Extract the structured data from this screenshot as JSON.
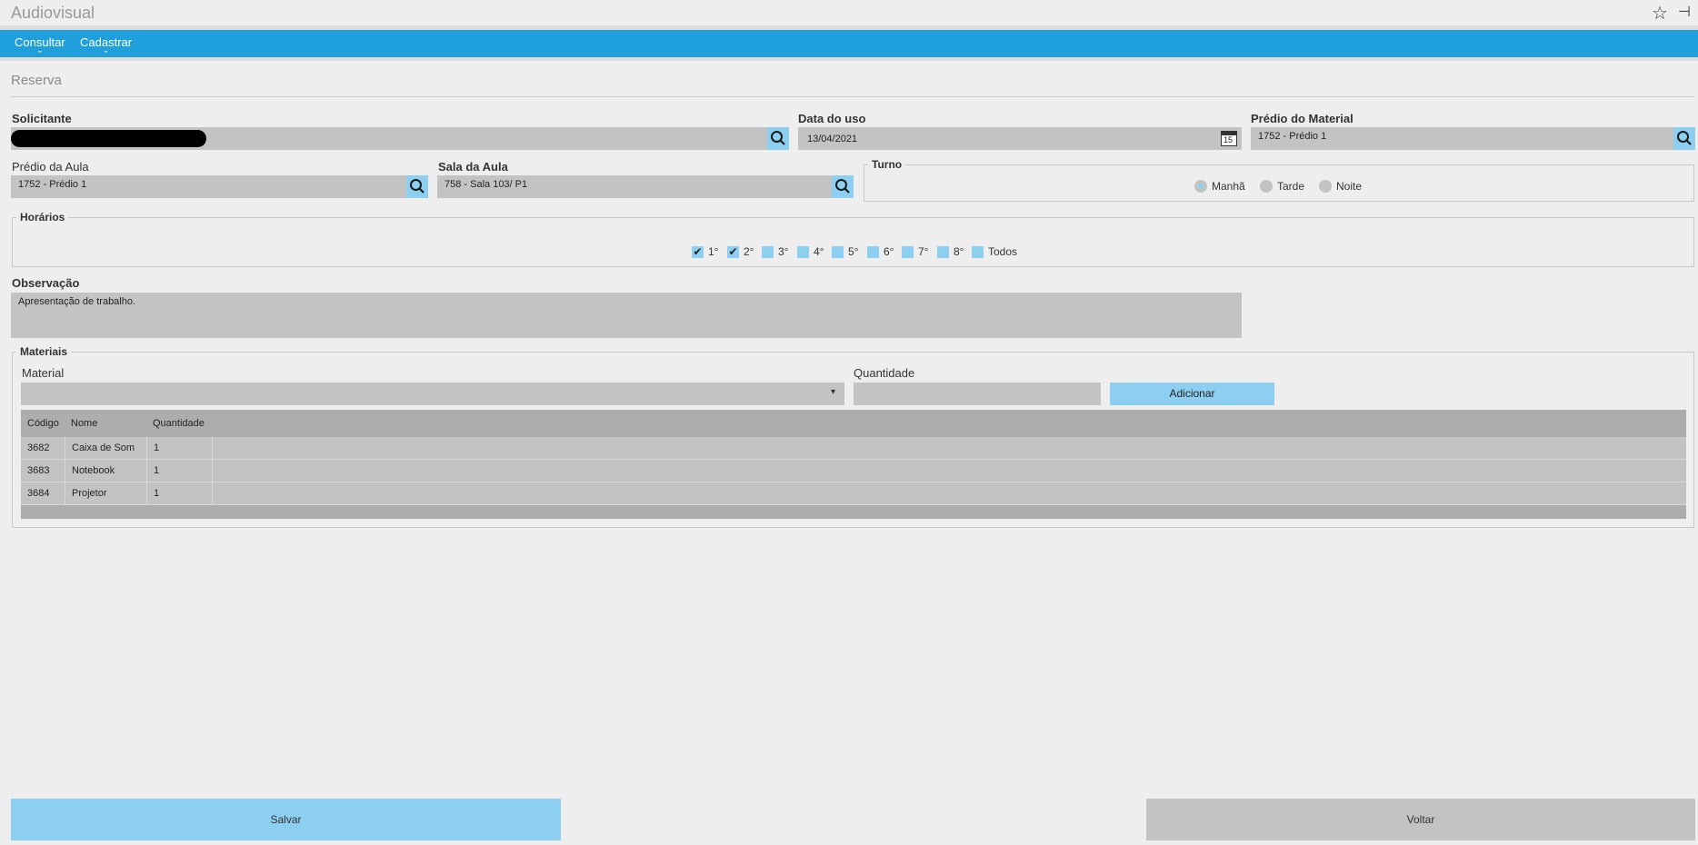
{
  "app": {
    "title": "Audiovisual"
  },
  "menu": [
    {
      "label": "Consultar"
    },
    {
      "label": "Cadastrar"
    }
  ],
  "section": {
    "title": "Reserva"
  },
  "solicitante": {
    "label": "Solicitante",
    "value": ""
  },
  "data_uso": {
    "label": "Data do uso",
    "value": "13/04/2021",
    "calendar_day": "15"
  },
  "predio_material": {
    "label": "Prédio do Material",
    "value": "1752 - Prédio 1"
  },
  "predio_aula": {
    "label": "Prédio da Aula",
    "value": "1752 - Prédio 1"
  },
  "sala_aula": {
    "label": "Sala da Aula",
    "value": "758 - Sala 103/ P1"
  },
  "turno": {
    "legend": "Turno",
    "options": [
      {
        "label": "Manhã",
        "selected": true
      },
      {
        "label": "Tarde",
        "selected": false
      },
      {
        "label": "Noite",
        "selected": false
      }
    ]
  },
  "horarios": {
    "legend": "Horários",
    "options": [
      {
        "label": "1°",
        "checked": true
      },
      {
        "label": "2°",
        "checked": true
      },
      {
        "label": "3°",
        "checked": false
      },
      {
        "label": "4°",
        "checked": false
      },
      {
        "label": "5°",
        "checked": false
      },
      {
        "label": "6°",
        "checked": false
      },
      {
        "label": "7°",
        "checked": false
      },
      {
        "label": "8°",
        "checked": false
      },
      {
        "label": "Todos",
        "checked": false
      }
    ]
  },
  "observacao": {
    "label": "Observação",
    "value": "Apresentação de trabalho."
  },
  "materiais": {
    "legend": "Materiais",
    "material_label": "Material",
    "material_value": "",
    "quantidade_label": "Quantidade",
    "quantidade_value": "",
    "add_button": "Adicionar",
    "columns": [
      "Código",
      "Nome",
      "Quantidade"
    ],
    "rows": [
      {
        "codigo": "3682",
        "nome": "Caixa de Som",
        "quantidade": "1"
      },
      {
        "codigo": "3683",
        "nome": "Notebook",
        "quantidade": "1"
      },
      {
        "codigo": "3684",
        "nome": "Projetor",
        "quantidade": "1"
      }
    ]
  },
  "actions": {
    "save": "Salvar",
    "back": "Voltar"
  },
  "icons": {
    "star": "star-icon",
    "pin": "pin-icon",
    "search": "search-icon",
    "calendar": "calendar-icon",
    "dropdown": "chevron-down-icon"
  },
  "colors": {
    "menubar": "#1fa0dc",
    "accent": "#8dcff0",
    "field": "#c3c3c3"
  }
}
